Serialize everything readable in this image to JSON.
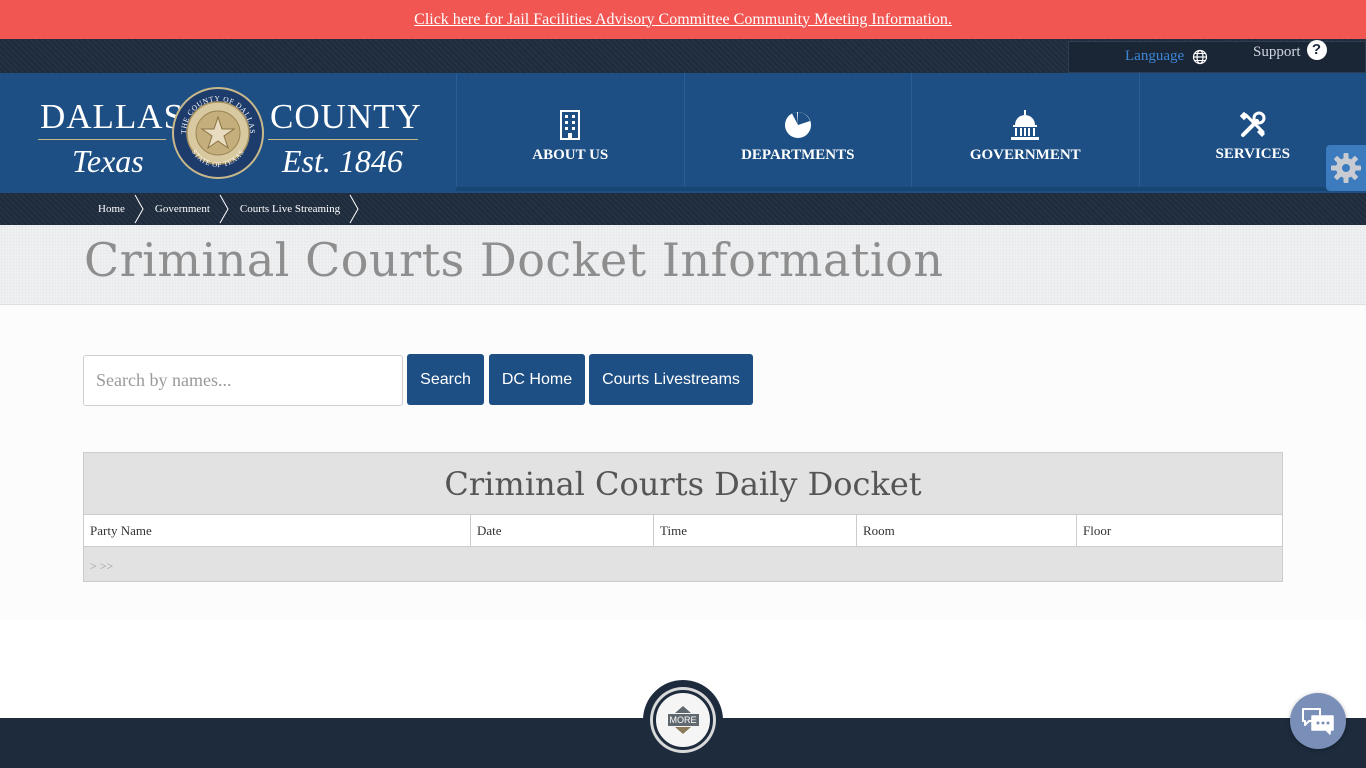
{
  "alert": {
    "link_text": "Click here for Jail Facilities Advisory Committee Community Meeting Information."
  },
  "utility": {
    "language": "Language",
    "support": "Support",
    "support_icon": "?"
  },
  "logo": {
    "left_top": "DALLAS",
    "right_top": "COUNTY",
    "left_bottom": "Texas",
    "right_bottom": "Est. 1846",
    "seal_text_top": "THE COUNTY OF DALLAS",
    "seal_text_bottom": "STATE OF TEXAS"
  },
  "nav": {
    "items": [
      {
        "label": "ABOUT US",
        "icon": "building-icon"
      },
      {
        "label": "DEPARTMENTS",
        "icon": "pie-chart-icon"
      },
      {
        "label": "GOVERNMENT",
        "icon": "capitol-icon"
      },
      {
        "label": "SERVICES",
        "icon": "tools-icon"
      }
    ]
  },
  "breadcrumb": {
    "items": [
      "Home",
      "Government",
      "Courts Live Streaming"
    ]
  },
  "page": {
    "title": "Criminal Courts Docket Information"
  },
  "search": {
    "placeholder": "Search by names...",
    "search_button": "Search",
    "home_button": "DC Home",
    "livestreams_button": "Courts Livestreams"
  },
  "docket": {
    "title": "Criminal Courts Daily Docket",
    "columns": [
      "Party Name",
      "Date",
      "Time",
      "Room",
      "Floor"
    ],
    "pager": "> >>"
  },
  "footer": {
    "more_label": "MORE"
  },
  "colors": {
    "alert": "#f25652",
    "header": "#1d4f84",
    "dark": "#1d2b3d",
    "button": "#1d4f84"
  }
}
